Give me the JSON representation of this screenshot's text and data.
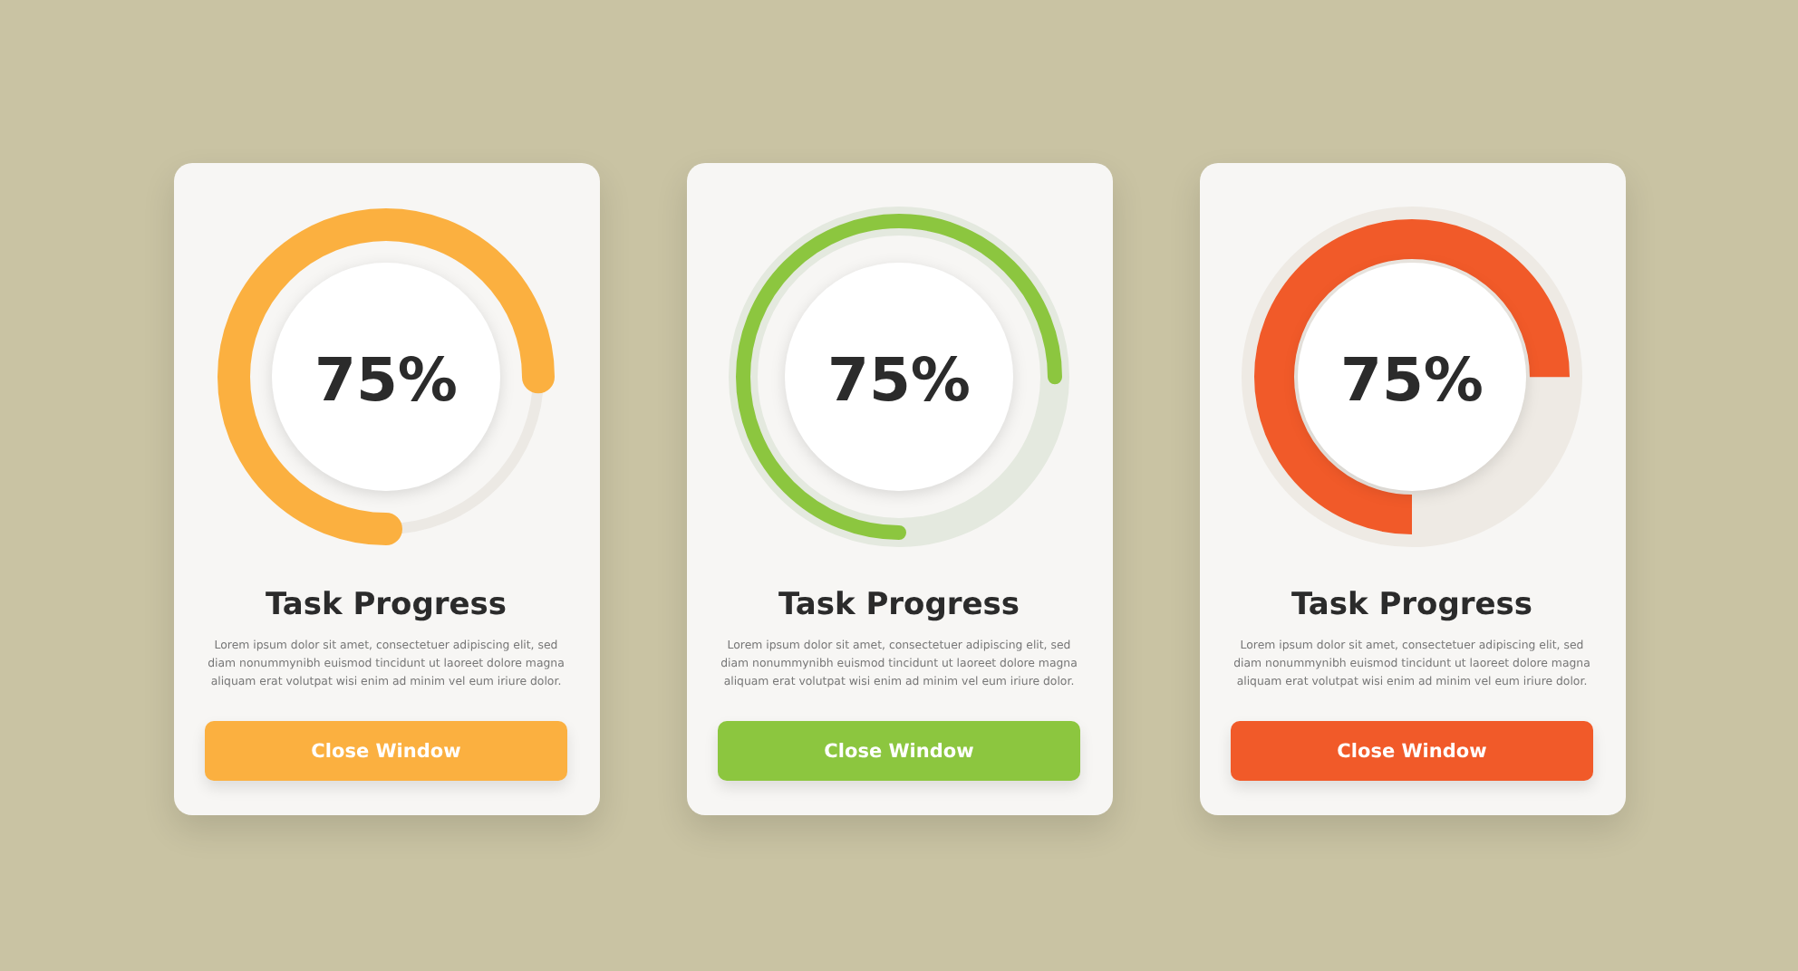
{
  "cards": [
    {
      "kind": "rounded",
      "color": "#fbb040",
      "level": 0.75,
      "percent": "75%",
      "title": "Task Progress",
      "text": "Lorem ipsum dolor sit amet, consectetuer adipiscing elit, sed diam nonummynibh euismod tincidunt ut laoreet dolore magna aliquam erat volutpat wisi enim ad minim vel eum iriure dolor.",
      "button": "Close Window"
    },
    {
      "kind": "thin",
      "color": "#8cc63f",
      "level": 0.75,
      "percent": "75%",
      "title": "Task Progress",
      "text": "Lorem ipsum dolor sit amet, consectetuer adipiscing elit, sed diam nonummynibh euismod tincidunt ut laoreet dolore magna aliquam erat volutpat wisi enim ad minim vel eum iriure dolor.",
      "button": "Close Window"
    },
    {
      "kind": "flat",
      "color": "#f15a29",
      "level": 0.75,
      "percent": "75%",
      "title": "Task Progress",
      "text": "Lorem ipsum dolor sit amet, consectetuer adipiscing elit, sed diam nonummynibh euismod tincidunt ut laoreet dolore magna aliquam erat volutpat wisi enim ad minim vel eum iriure dolor.",
      "button": "Close Window"
    }
  ]
}
